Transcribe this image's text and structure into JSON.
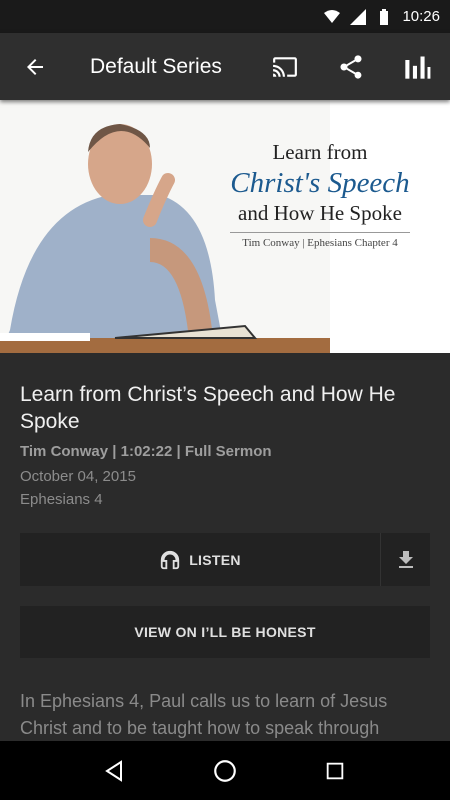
{
  "status_bar": {
    "time": "10:26",
    "icons": [
      "wifi-icon",
      "signal-icon",
      "battery-icon"
    ]
  },
  "app_bar": {
    "title": "Default Series",
    "actions": [
      "cast-icon",
      "share-icon",
      "stats-icon"
    ]
  },
  "hero": {
    "line1": "Learn from",
    "line2": "Christ's Speech",
    "line3": "and How He Spoke",
    "subtitle": "Tim Conway | Ephesians Chapter 4"
  },
  "sermon": {
    "title": "Learn from Christ’s Speech and How He Spoke",
    "meta": "Tim Conway | 1:02:22 | Full Sermon",
    "date": "October 04, 2015",
    "passage": "Ephesians 4"
  },
  "buttons": {
    "listen": "LISTEN",
    "view": "VIEW ON I’LL BE HONEST"
  },
  "description": "In Ephesians 4, Paul calls us to learn of Jesus Christ and to be taught how to speak through",
  "colors": {
    "accent_blue": "#1c5a8f",
    "background": "#2b2b2b",
    "app_bar": "#2f2f2f"
  }
}
